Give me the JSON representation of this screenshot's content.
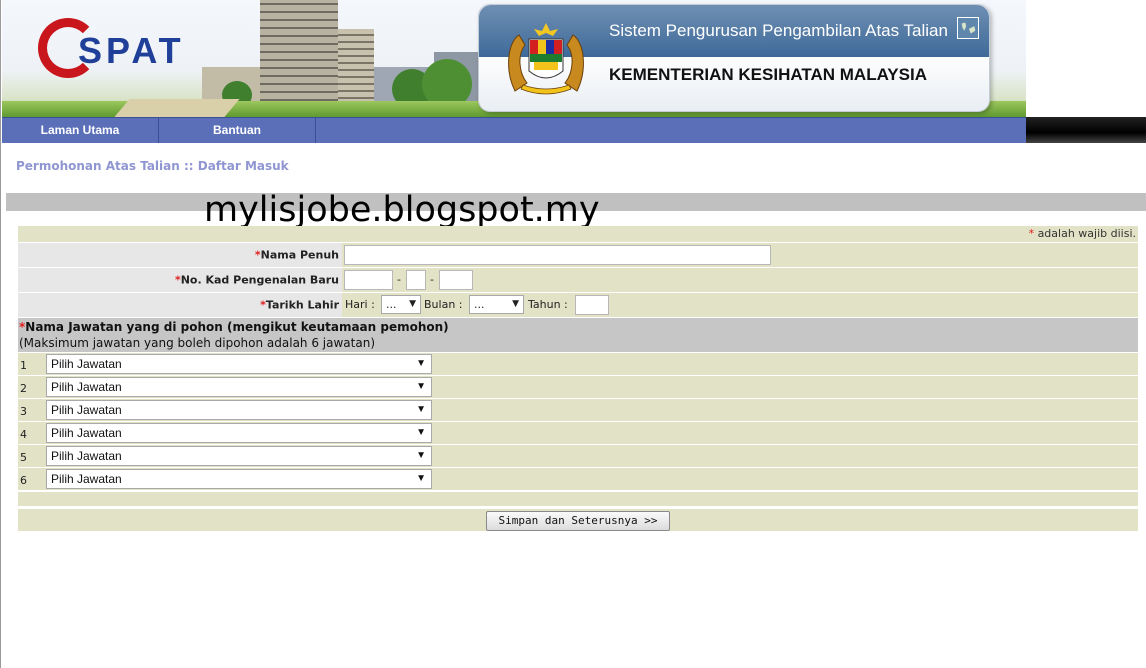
{
  "header": {
    "logo_text": "SPAT",
    "system_title": "Sistem Pengurusan Pengambilan Atas Talian",
    "ministry": "KEMENTERIAN KESIHATAN MALAYSIA"
  },
  "nav": {
    "items": [
      "Laman Utama",
      "Bantuan"
    ]
  },
  "breadcrumb": "Permohonan Atas Talian :: Daftar Masuk",
  "watermark": "mylisjobe.blogspot.my",
  "form": {
    "required_star": "*",
    "required_note": "adalah wajib diisi.",
    "fields": {
      "nama": {
        "label": "Nama Penuh",
        "value": ""
      },
      "ic": {
        "label": "No. Kad Pengenalan Baru",
        "separator": "-"
      },
      "dob": {
        "label": "Tarikh Lahir",
        "day_label": "Hari :",
        "day_value": "...",
        "month_label": "Bulan :",
        "month_value": "...",
        "year_label": "Tahun :"
      }
    },
    "jobs": {
      "heading": "Nama Jawatan yang di pohon (mengikut keutamaan pemohon)",
      "subheading": "(Maksimum jawatan yang boleh dipohon adalah 6 jawatan)",
      "items": [
        {
          "no": "1",
          "value": "Pilih Jawatan"
        },
        {
          "no": "2",
          "value": "Pilih Jawatan"
        },
        {
          "no": "3",
          "value": "Pilih Jawatan"
        },
        {
          "no": "4",
          "value": "Pilih Jawatan"
        },
        {
          "no": "5",
          "value": "Pilih Jawatan"
        },
        {
          "no": "6",
          "value": "Pilih Jawatan"
        }
      ]
    },
    "submit_label": "Simpan dan Seterusnya >>"
  },
  "colors": {
    "nav_bg": "#5a6fb7",
    "row_bg": "#e2e2c7",
    "label_bg": "#e7e7e7",
    "breadcrumb": "#8f96d2",
    "required": "#e02020"
  },
  "icons": [
    "logo-crescent-icon",
    "coat-of-arms-icon",
    "malaysia-map-icon",
    "dropdown-arrow-icon"
  ]
}
